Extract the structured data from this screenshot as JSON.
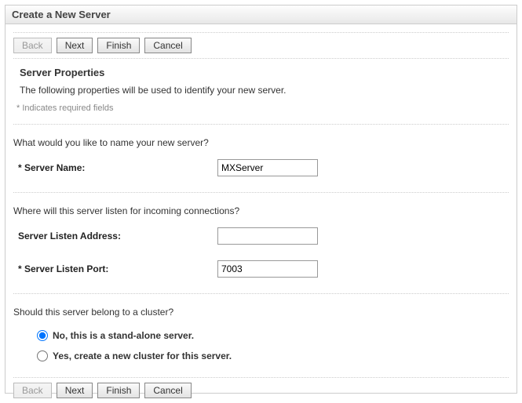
{
  "title": "Create a New Server",
  "buttons": {
    "back": "Back",
    "next": "Next",
    "finish": "Finish",
    "cancel": "Cancel"
  },
  "section": {
    "heading": "Server Properties",
    "description": "The following properties will be used to identify your new server.",
    "required_note": "* Indicates required fields"
  },
  "question1": "What would you like to name your new server?",
  "server_name": {
    "label": "* Server Name:",
    "value": "MXServer"
  },
  "question2": "Where will this server listen for incoming connections?",
  "listen_address": {
    "label": "Server Listen Address:",
    "value": ""
  },
  "listen_port": {
    "label": "* Server Listen Port:",
    "value": "7003"
  },
  "question3": "Should this server belong to a cluster?",
  "cluster": {
    "option_no": "No, this is a stand-alone server.",
    "option_yes": "Yes, create a new cluster for this server."
  }
}
